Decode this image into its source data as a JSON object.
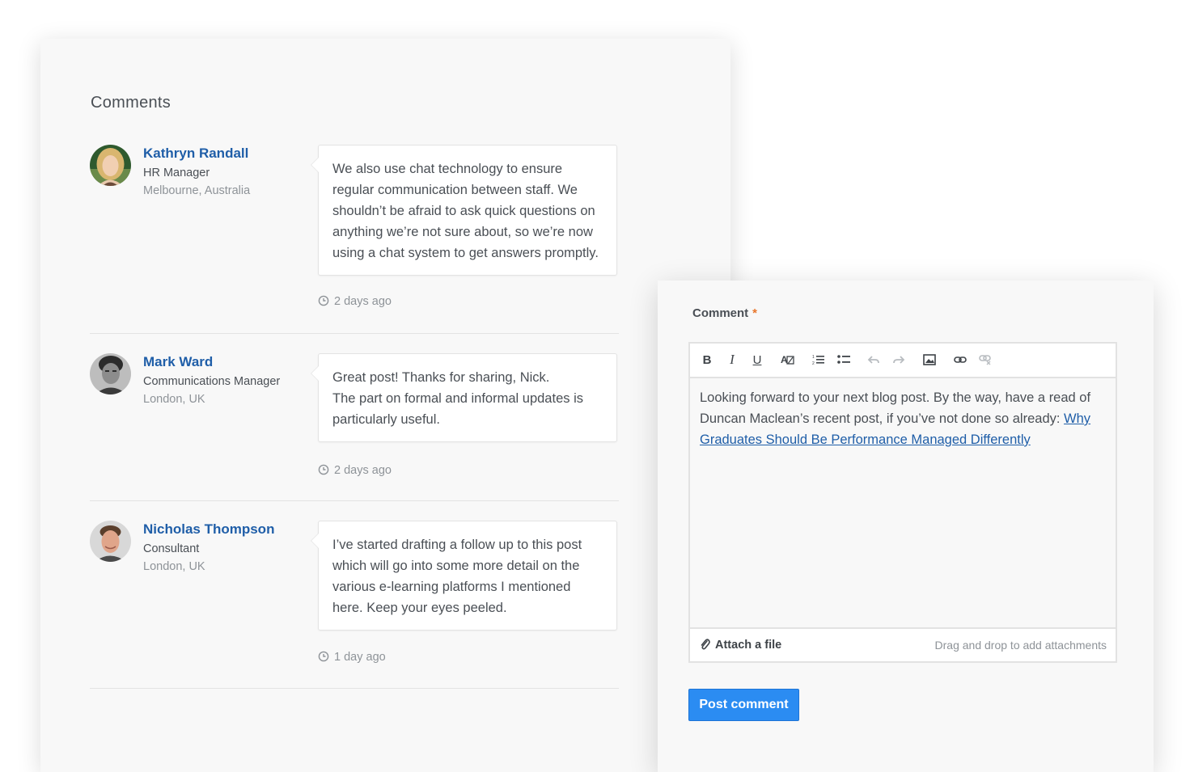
{
  "comments_section": {
    "title": "Comments",
    "comments": [
      {
        "author": "Kathryn Randall",
        "role": "HR Manager",
        "location": "Melbourne, Australia",
        "body": "We also use chat technology to ensure regular communication between staff. We shouldn’t be afraid to ask quick questions on anything we’re not sure about, so we’re now using a chat system to get answers promptly.",
        "time": "2 days ago"
      },
      {
        "author": "Mark Ward",
        "role": "Communications Manager",
        "location": "London, UK",
        "body_line1": "Great post! Thanks for sharing, Nick.",
        "body_line2": "The part on formal and informal updates is particularly useful.",
        "time": "2 days ago"
      },
      {
        "author": "Nicholas Thompson",
        "role": "Consultant",
        "location": "London, UK",
        "body": "I’ve started drafting a follow up to this post which will go into some more detail on the various e-learning platforms I mentioned here. Keep your eyes peeled.",
        "time": "1 day ago"
      }
    ]
  },
  "comment_form": {
    "label": "Comment",
    "required_marker": "*",
    "toolbar_icons": [
      "bold-icon",
      "italic-icon",
      "underline-icon",
      "remove-format-icon",
      "ordered-list-icon",
      "bullet-list-icon",
      "undo-icon",
      "redo-icon",
      "image-icon",
      "link-icon",
      "unlink-icon"
    ],
    "editor_text": "Looking forward to your next blog post. By the way, have a read of Duncan Maclean’s recent post, if you’ve not done so already: ",
    "editor_link_text": "Why Graduates Should Be Performance Managed Differently",
    "attach_label": "Attach a file",
    "attach_hint": "Drag and drop to add attachments",
    "submit_label": "Post comment"
  },
  "colors": {
    "link": "#1f5ea8",
    "primary_button": "#2b8cf2",
    "required": "#e8762b",
    "panel_bg": "#f8f8f8"
  }
}
